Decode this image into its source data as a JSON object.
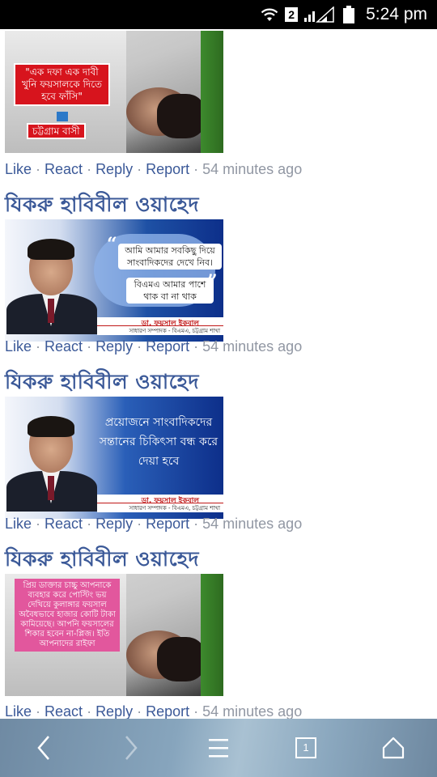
{
  "status_bar": {
    "sim_number": "2",
    "time": "5:24 pm"
  },
  "posts": [
    {
      "author": "",
      "image": {
        "kind": "photo-with-red-slogan",
        "slogan": "\"এক দফা এক দাবী খুনি ফয়সালকে দিতে হবে ফাঁসি\"",
        "tag": "চট্টগ্রাম বাসী"
      },
      "actions": {
        "like": "Like",
        "react": "React",
        "reply": "Reply",
        "report": "Report",
        "time": "54 minutes ago"
      }
    },
    {
      "author": "যিকরু হাবিবীল ওয়াহেদ",
      "image": {
        "kind": "banner-speech",
        "line1": "আমি আমার সবকিছু দিয়ে সাংবাদিকদের দেখে নিব।",
        "line2": "বিএমএ আমার পাশে থাক বা না থাক",
        "footer_name": "ডা. ফয়সাল ইকবাল",
        "footer_role": "সাধারণ সম্পাদক - বিএমএ, চট্টগ্রাম শাখা"
      },
      "actions": {
        "like": "Like",
        "react": "React",
        "reply": "Reply",
        "report": "Report",
        "time": "54 minutes ago"
      }
    },
    {
      "author": "যিকরু হাবিবীল ওয়াহেদ",
      "image": {
        "kind": "banner-quote",
        "quote": "প্রয়োজনে সাংবাদিকদের সন্তানের চিকিৎসা বন্ধ করে দেয়া হবে",
        "footer_name": "ডা. ফয়সাল ইকবাল",
        "footer_role": "সাধারণ সম্পাদক - বিএমএ, চট্টগ্রাম শাখা"
      },
      "actions": {
        "like": "Like",
        "react": "React",
        "reply": "Reply",
        "report": "Report",
        "time": "54 minutes ago"
      }
    },
    {
      "author": "যিকরু হাবিবীল ওয়াহেদ",
      "image": {
        "kind": "photo-with-pink-card",
        "text": "প্রিয় ডাক্তার চাচ্চু আপনাকে ব্যবহার করে পোস্টিং ভয় দেখিয়ে কুলাঙ্গার ফয়সাল অবৈধভাবে হাজার কোটি টাকা কামিয়েছে। আপনি ফয়সালের শিকার হবেন না-প্লিজ। ইতি আপনাদের রাইফা"
      },
      "actions": {
        "like": "Like",
        "react": "React",
        "reply": "Reply",
        "report": "Report",
        "time": "54 minutes ago"
      }
    }
  ],
  "nav": {
    "back": "back-icon",
    "forward": "forward-icon",
    "menu": "menu-icon",
    "tabs_count": "1",
    "home": "home-icon"
  },
  "colors": {
    "link": "#3b5998",
    "meta": "#9197a3",
    "status_bar": "#000000"
  }
}
